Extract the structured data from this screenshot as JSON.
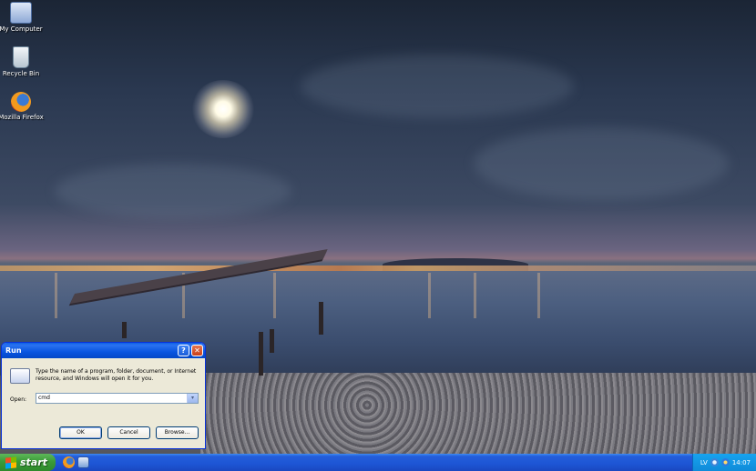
{
  "desktop": {
    "icons": [
      {
        "label": "My Computer",
        "icon": "my-computer-icon"
      },
      {
        "label": "Recycle Bin",
        "icon": "recycle-bin-icon"
      },
      {
        "label": "Mozilla Firefox",
        "icon": "firefox-icon"
      }
    ]
  },
  "run_dialog": {
    "title": "Run",
    "help_glyph": "?",
    "close_glyph": "✕",
    "description": "Type the name of a program, folder, document, or Internet resource, and Windows will open it for you.",
    "open_label": "Open:",
    "open_value": "cmd",
    "dropdown_glyph": "▾",
    "ok_label": "OK",
    "cancel_label": "Cancel",
    "browse_label": "Browse..."
  },
  "taskbar": {
    "start_label": "start",
    "quick_launch": [
      "firefox-icon",
      "show-desktop-icon"
    ],
    "tray": {
      "language": "LV",
      "clock": "14:07"
    }
  },
  "colors": {
    "taskbar_blue": "#245edb",
    "start_green": "#3a9b37",
    "titlebar_blue": "#0854e0",
    "dialog_bg": "#ece9d8"
  }
}
